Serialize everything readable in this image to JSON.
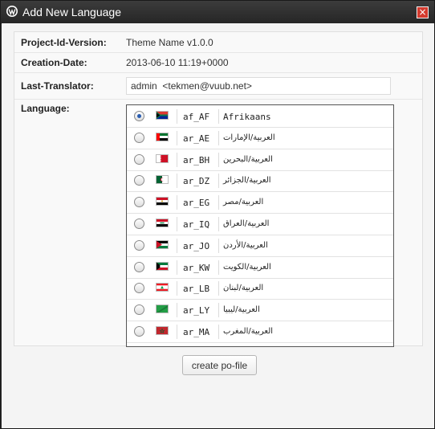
{
  "dialog": {
    "title": "Add New Language",
    "close_label": "×",
    "icon": "wordpress-logo-icon"
  },
  "form": {
    "project_id": {
      "label": "Project-Id-Version:",
      "value": "Theme Name v1.0.0"
    },
    "creation_date": {
      "label": "Creation-Date:",
      "value": "2013-06-10 11:19+0000"
    },
    "last_translator": {
      "label": "Last-Translator:",
      "value": "admin  <tekmen@vuub.net>"
    },
    "language": {
      "label": "Language:"
    }
  },
  "languages": [
    {
      "code": "af_AF",
      "name": "Afrikaans",
      "selected": true
    },
    {
      "code": "ar_AE",
      "name": "العربية/الإمارات",
      "selected": false
    },
    {
      "code": "ar_BH",
      "name": "العربية/البحرين",
      "selected": false
    },
    {
      "code": "ar_DZ",
      "name": "العربية/الجزائر",
      "selected": false
    },
    {
      "code": "ar_EG",
      "name": "العربية/مصر",
      "selected": false
    },
    {
      "code": "ar_IQ",
      "name": "العربية/العراق",
      "selected": false
    },
    {
      "code": "ar_JO",
      "name": "العربية/الأردن",
      "selected": false
    },
    {
      "code": "ar_KW",
      "name": "العربية/الكويت",
      "selected": false
    },
    {
      "code": "ar_LB",
      "name": "العربية/لبنان",
      "selected": false
    },
    {
      "code": "ar_LY",
      "name": "العربية/ليبيا",
      "selected": false
    },
    {
      "code": "ar_MA",
      "name": "العربية/المغرب",
      "selected": false
    }
  ],
  "actions": {
    "create_label": "create po-file"
  }
}
